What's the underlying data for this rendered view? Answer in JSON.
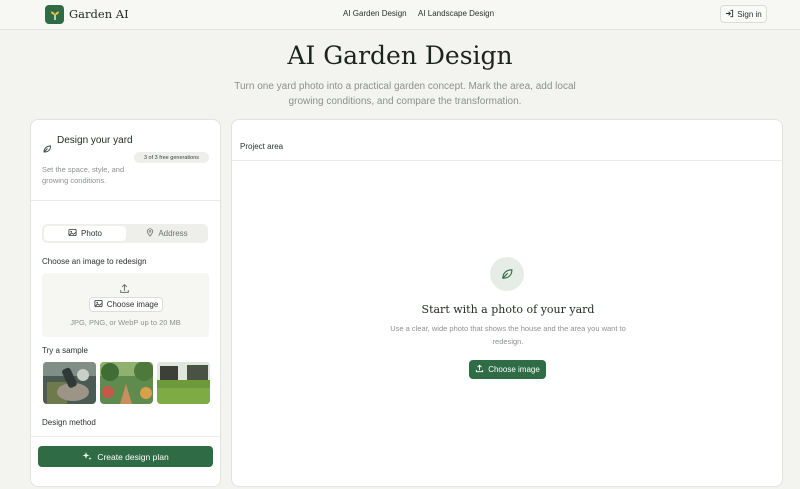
{
  "header": {
    "brand": "Garden AI",
    "nav": [
      "AI Garden Design",
      "AI Landscape Design"
    ],
    "signin_label": "Sign in"
  },
  "hero": {
    "title": "AI Garden Design",
    "subtitle": "Turn one yard photo into a practical garden concept. Mark the area, add local growing conditions, and compare the transformation."
  },
  "left_panel": {
    "title": "Design your yard",
    "badge": "3 of 3 free generations",
    "description": "Set the space, style, and growing conditions.",
    "tabs": [
      "Photo",
      "Address"
    ],
    "choose_label": "Choose an image to redesign",
    "choose_button": "Choose image",
    "formats": "JPG, PNG, or WebP up to 20 MB",
    "samples_label": "Try a sample",
    "method_label": "Design method",
    "create_button": "Create design plan"
  },
  "right_panel": {
    "project_label": "Project area",
    "empty_title": "Start with a photo of your yard",
    "empty_desc": "Use a clear, wide photo that shows the house and the area you want to redesign.",
    "choose_button": "Choose image"
  },
  "colors": {
    "accent": "#2f6b45",
    "background": "#f3f3ef"
  },
  "icons": [
    "sprout-logo-icon",
    "sign-in-icon",
    "leaf-icon",
    "image-icon",
    "map-pin-icon",
    "upload-icon",
    "sparkles-icon"
  ]
}
